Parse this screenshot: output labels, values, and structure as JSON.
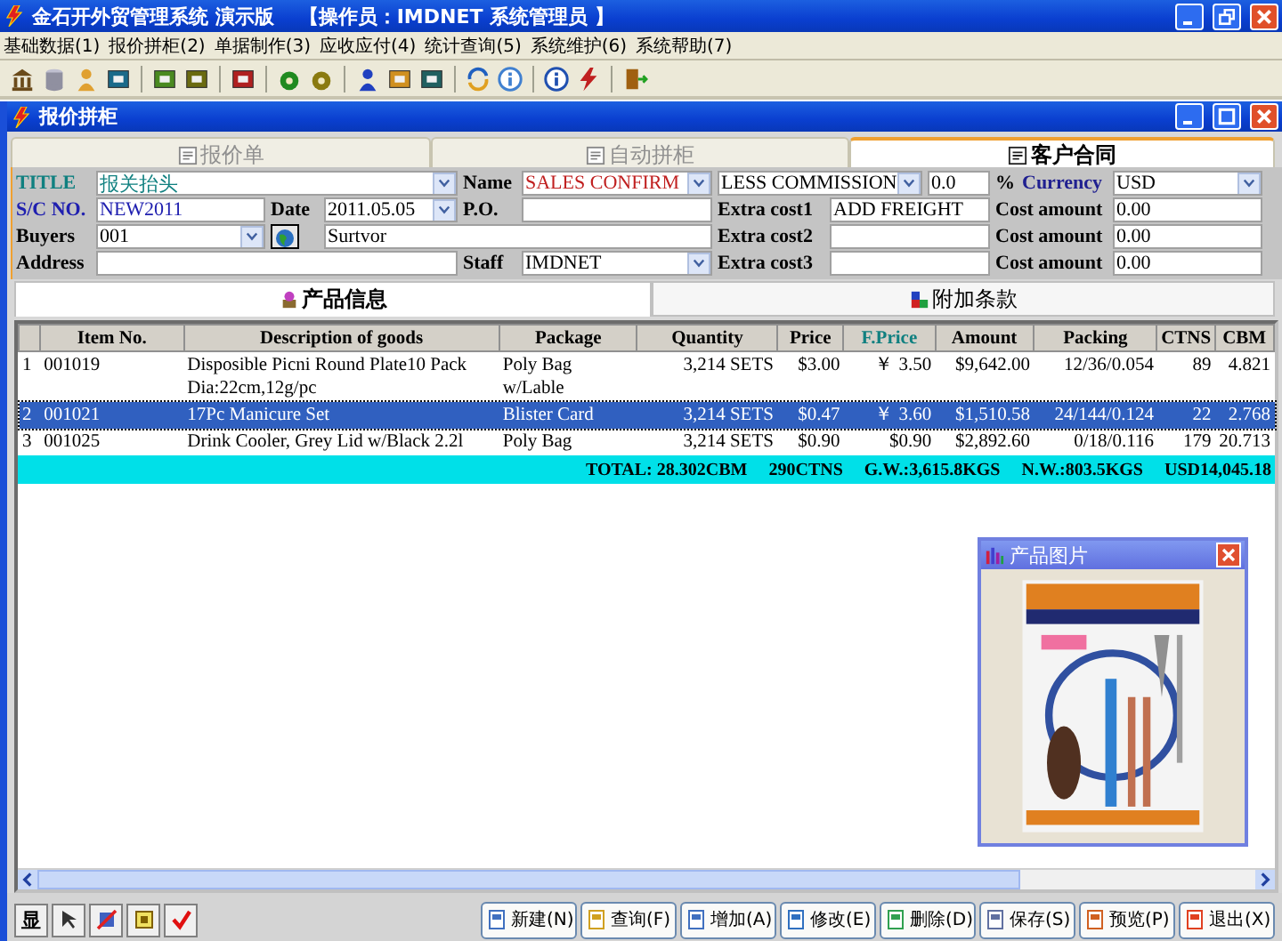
{
  "window": {
    "title": "金石开外贸管理系统 演示版",
    "operator": "【操作员：IMDNET   系统管理员 】"
  },
  "menu": [
    "基础数据(1)",
    "报价拼柜(2)",
    "单据制作(3)",
    "应收应付(4)",
    "统计查询(5)",
    "系统维护(6)",
    "系统帮助(7)"
  ],
  "child_window": {
    "title": "报价拼柜"
  },
  "tabs": [
    {
      "label": "报价单",
      "selected": false
    },
    {
      "label": "自动拼柜",
      "selected": false
    },
    {
      "label": "客户合同",
      "selected": true
    }
  ],
  "form": [
    [
      {
        "kind": "label",
        "text": "TITLE",
        "color": "#108080"
      },
      {
        "kind": "select",
        "text": "报关抬头",
        "color": "#108080"
      },
      {
        "kind": "label",
        "text": "Name",
        "color": "#000000"
      },
      {
        "kind": "select",
        "text": "SALES  CONFIRM",
        "color": "#c02020"
      },
      {
        "kind": "select",
        "text": "LESS COMMISSION",
        "color": "#000000"
      },
      {
        "kind": "text",
        "text": "0.0",
        "color": "#000000"
      },
      {
        "kind": "label",
        "text": "%",
        "color": "#000000"
      },
      {
        "kind": "label",
        "text": "Currency",
        "color": "#202090"
      },
      {
        "kind": "select",
        "text": "USD",
        "color": "#000000"
      }
    ],
    [
      {
        "kind": "label",
        "text": "S/C NO.",
        "color": "#2020b0"
      },
      {
        "kind": "text",
        "text": "NEW2011",
        "color": "#2020b0"
      },
      {
        "kind": "label",
        "text": "Date",
        "color": "#000000"
      },
      {
        "kind": "select",
        "text": "2011.05.05",
        "color": "#000000"
      },
      {
        "kind": "label",
        "text": "P.O.",
        "color": "#000000"
      },
      {
        "kind": "text"
      },
      {
        "kind": "label",
        "text": "Extra cost1",
        "color": "#000000"
      },
      {
        "kind": "text",
        "text": "ADD FREIGHT",
        "color": "#000000"
      },
      {
        "kind": "label",
        "text": "Cost amount",
        "color": "#000000"
      },
      {
        "kind": "text",
        "text": "0.00",
        "color": "#000000"
      }
    ],
    [
      {
        "kind": "label",
        "text": "Buyers",
        "color": "#000000"
      },
      {
        "kind": "select",
        "text": "001",
        "color": "#000000"
      },
      {
        "kind": "button",
        "color": "#000000"
      },
      {
        "kind": "text",
        "text": "Surtvor",
        "color": "#000000"
      },
      {
        "kind": "label",
        "text": "Extra cost2",
        "color": "#000000"
      },
      {
        "kind": "text"
      },
      {
        "kind": "label",
        "text": "Cost amount",
        "color": "#000000"
      },
      {
        "kind": "text",
        "text": "0.00",
        "color": "#000000"
      }
    ],
    [
      {
        "kind": "label",
        "text": "Address",
        "color": "#000000"
      },
      {
        "kind": "text"
      },
      {
        "kind": "label",
        "text": "Staff",
        "color": "#000000"
      },
      {
        "kind": "select",
        "text": "IMDNET",
        "color": "#000000"
      },
      {
        "kind": "label",
        "text": "Extra cost3",
        "color": "#000000"
      },
      {
        "kind": "text"
      },
      {
        "kind": "label",
        "text": "Cost amount",
        "color": "#000000"
      },
      {
        "kind": "text",
        "text": "0.00",
        "color": "#000000"
      }
    ]
  ],
  "subtabs": [
    {
      "label": "产品信息",
      "selected": true
    },
    {
      "label": "附加条款",
      "selected": false
    }
  ],
  "table": {
    "columns": [
      {
        "emphasized": false
      },
      {
        "label": "Item No.",
        "emphasized": false
      },
      {
        "label": "Description of goods",
        "emphasized": false
      },
      {
        "label": "Package",
        "emphasized": false
      },
      {
        "label": "Quantity",
        "emphasized": false
      },
      {
        "label": "Price",
        "emphasized": false
      },
      {
        "label": "F.Price",
        "emphasized": true
      },
      {
        "label": "Amount",
        "emphasized": false
      },
      {
        "label": "Packing",
        "emphasized": false
      },
      {
        "label": "CTNS",
        "emphasized": false
      },
      {
        "label": "CBM",
        "emphasized": false
      }
    ],
    "rows": [
      {
        "selected": false,
        "cells": [
          "1",
          "001019",
          "Disposible Picni Round Plate10 Pack Dia:22cm,12g/pc",
          "Poly Bag w/Lable",
          "3,214 SETS",
          "$3.00",
          "￥ 3.50",
          "$9,642.00",
          "12/36/0.054",
          "89",
          "4.821"
        ]
      },
      {
        "selected": true,
        "cells": [
          "2",
          "001021",
          "17Pc Manicure Set",
          "Blister Card",
          "3,214 SETS",
          "$0.47",
          "￥ 3.60",
          "$1,510.58",
          "24/144/0.124",
          "22",
          "2.768"
        ]
      },
      {
        "selected": false,
        "cells": [
          "3",
          "001025",
          "Drink Cooler, Grey Lid w/Black 2.2l",
          "Poly Bag",
          "3,214 SETS",
          "$0.90",
          "$0.90",
          "$2,892.60",
          "0/18/0.116",
          "179",
          "20.713"
        ]
      }
    ],
    "totals": [
      "TOTAL: 28.302CBM",
      "290CTNS",
      "G.W.:3,615.8KGS",
      "N.W.:803.5KGS",
      "USD14,045.18"
    ]
  },
  "picture_window": {
    "title": "产品图片"
  },
  "left_buttons": [
    "显"
  ],
  "buttons": [
    "新建(N)",
    "查询(F)",
    "增加(A)",
    "修改(E)",
    "删除(D)",
    "保存(S)",
    "预览(P)",
    "退出(X)"
  ]
}
